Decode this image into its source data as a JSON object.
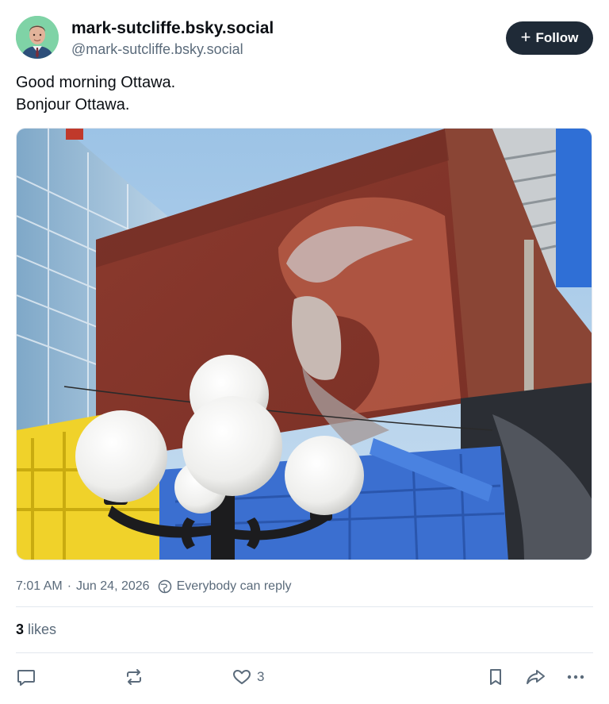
{
  "author": {
    "display_name": "mark-sutcliffe.bsky.social",
    "handle": "@mark-sutcliffe.bsky.social"
  },
  "follow_button": {
    "label": "Follow",
    "icon": "plus-icon"
  },
  "post": {
    "lines": [
      "Good morning Ottawa.",
      "Bonjour Ottawa."
    ]
  },
  "meta": {
    "time": "7:01 AM",
    "separator": "·",
    "date": "Jun 24, 2026",
    "reply_setting": "Everybody can reply"
  },
  "likes": {
    "count": "3",
    "label": "likes"
  },
  "actions": {
    "reply_icon": "comment-icon",
    "repost_icon": "repost-icon",
    "like_icon": "heart-icon",
    "like_count": "3",
    "bookmark_icon": "bookmark-icon",
    "share_icon": "share-icon",
    "more_icon": "ellipsis-icon"
  },
  "colors": {
    "follow_bg": "#1f2a37",
    "muted_text": "#5b6b7b",
    "divider": "#e3e8ee"
  }
}
